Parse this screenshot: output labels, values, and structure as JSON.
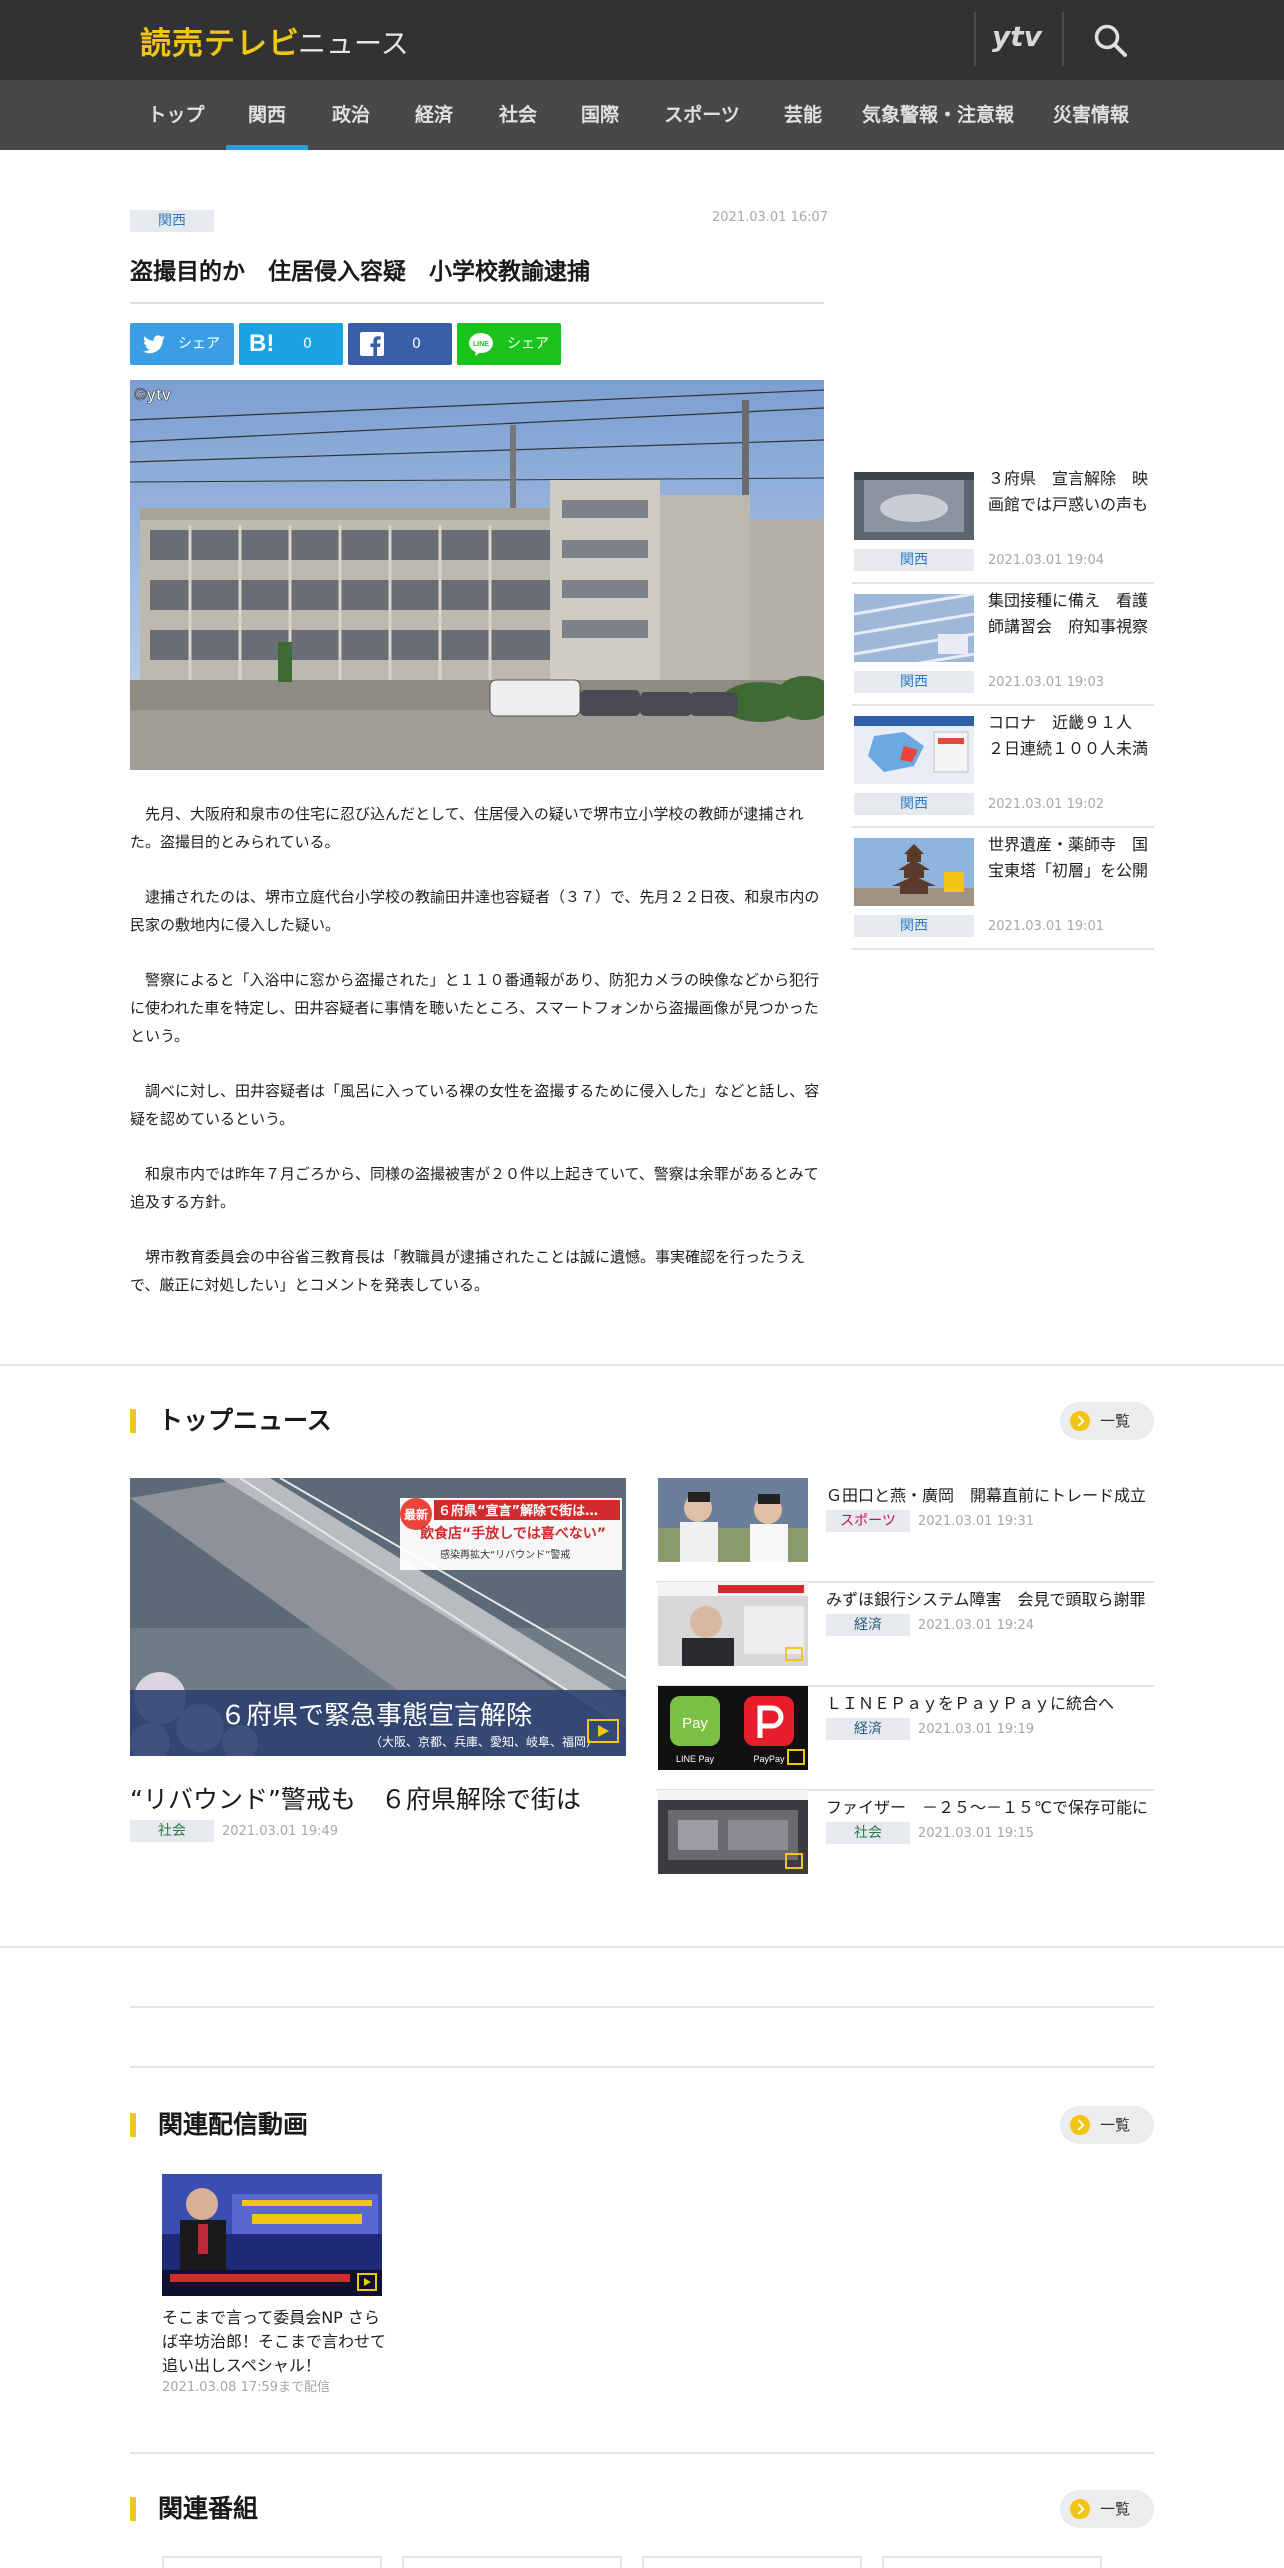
{
  "header": {
    "logo": "読売テレビ",
    "logo_sub": "ニュース",
    "ytv": "ytv"
  },
  "nav": {
    "items": [
      "トップ",
      "関西",
      "政治",
      "経済",
      "社会",
      "国際",
      "スポーツ",
      "芸能",
      "気象警報・注意報",
      "災害情報"
    ],
    "active": "関西"
  },
  "article": {
    "category": "関西",
    "date": "2021.03.01 16:07",
    "title": "盗撮目的か　住居侵入容疑　小学校教諭逮捕",
    "share": {
      "twitter_label": "シェア",
      "hatena_count": "0",
      "facebook_count": "0",
      "line_label": "シェア"
    },
    "photo_watermark": "©ytv",
    "paragraphs": [
      "先月、大阪府和泉市の住宅に忍び込んだとして、住居侵入の疑いで堺市立小学校の教師が逮捕された。盗撮目的とみられている。",
      "逮捕されたのは、堺市立庭代台小学校の教諭田井達也容疑者（３７）で、先月２２日夜、和泉市内の民家の敷地内に侵入した疑い。",
      "警察によると「入浴中に窓から盗撮された」と１１０番通報があり、防犯カメラの映像などから犯行に使われた車を特定し、田井容疑者に事情を聴いたところ、スマートフォンから盗撮画像が見つかったという。",
      "調べに対し、田井容疑者は「風呂に入っている裸の女性を盗撮するために侵入した」などと話し、容疑を認めているという。",
      "和泉市内では昨年７月ごろから、同様の盗撮被害が２０件以上起きていて、警察は余罪があるとみて追及する方針。",
      "堺市教育委員会の中谷省三教育長は「教職員が逮捕されたことは誠に遺憾。事実確認を行ったうえで、厳正に対処したい」とコメントを発表している。"
    ]
  },
  "sidebar": {
    "items": [
      {
        "title": "３府県　宣言解除　映画館では戸惑いの声も",
        "category": "関西",
        "date": "2021.03.01 19:04"
      },
      {
        "title": "集団接種に備え　看護師講習会　府知事視察",
        "category": "関西",
        "date": "2021.03.01 19:03"
      },
      {
        "title": "コロナ　近畿９１人　２日連続１００人未満",
        "category": "関西",
        "date": "2021.03.01 19:02"
      },
      {
        "title": "世界遺産・薬師寺　国宝東塔「初層」を公開",
        "category": "関西",
        "date": "2021.03.01 19:01"
      }
    ]
  },
  "top_news": {
    "heading": "トップニュース",
    "more": "一覧",
    "main": {
      "title": "“リバウンド”警戒も　６府県解除で街は",
      "category": "社会",
      "date": "2021.03.01 19:49",
      "image_caption": "６府県で緊急事態宣言解除",
      "image_caption_sub": "（大阪、京都、兵庫、愛知、岐阜、福岡）",
      "image_banner_tag": "最新",
      "image_banner_line1": "６府県“宣言”解除で街は…",
      "image_banner_line2": "飲食店“手放しでは喜べない”",
      "image_banner_line3": "感染再拡大“リバウンド”警戒"
    },
    "items": [
      {
        "title": "Ｇ田口と燕・廣岡　開幕直前にトレード成立",
        "category": "スポーツ",
        "date": "2021.03.01 19:31"
      },
      {
        "title": "みずほ銀行システム障害　会見で頭取ら謝罪",
        "category": "経済",
        "date": "2021.03.01 19:24"
      },
      {
        "title": "ＬＩＮＥＰａｙをＰａｙＰａｙに統合へ",
        "category": "経済",
        "date": "2021.03.01 19:19",
        "thumb_left": "Pay",
        "thumb_left_sub": "LINE Pay",
        "thumb_right_sub": "PayPay"
      },
      {
        "title": "ファイザー　－２５～－１５℃で保存可能に",
        "category": "社会",
        "date": "2021.03.01 19:15"
      }
    ]
  },
  "related_videos": {
    "heading": "関連配信動画",
    "more": "一覧",
    "items": [
      {
        "title": "そこまで言って委員会NP さらば辛坊治郎！そこまで言わせて追い出しスペシャル！",
        "note": "2021.03.08 17:59まで配信"
      }
    ]
  },
  "related_programs": {
    "heading": "関連番組",
    "more": "一覧"
  },
  "colors": {
    "header_bg": "#323232",
    "nav_bg": "#484848",
    "accent_yellow": "#f2c413",
    "nav_active": "#2a9fdc",
    "twitter": "#3a9ee4",
    "hatena": "#1aa3e0",
    "facebook": "#3a5ea8",
    "line": "#19c319"
  }
}
